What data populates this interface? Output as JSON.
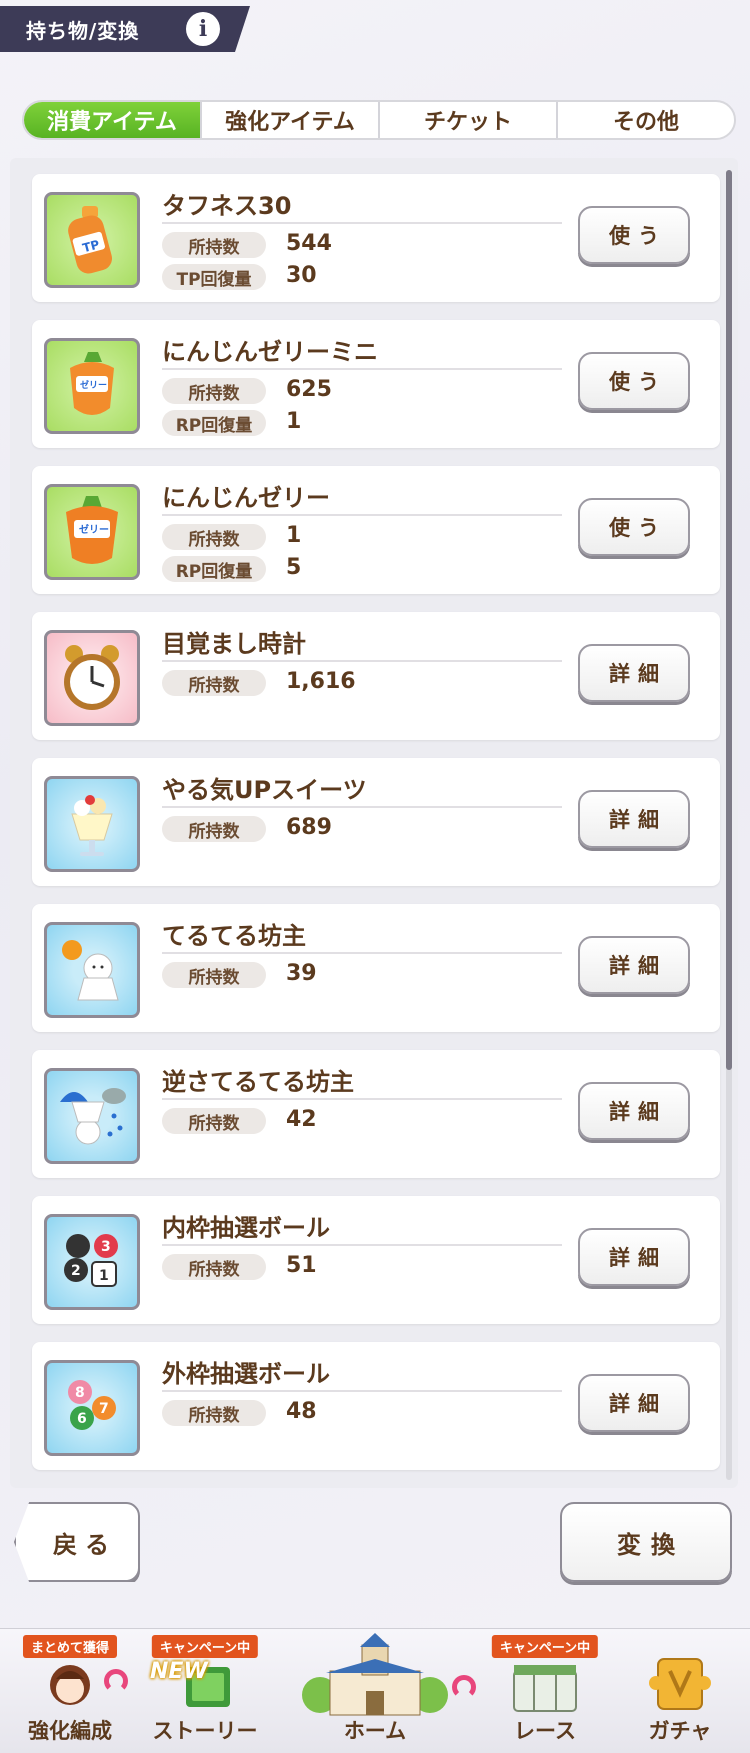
{
  "header": {
    "title": "持ち物/変換",
    "info_icon": "i"
  },
  "tabs": [
    {
      "label": "消費アイテム",
      "active": true
    },
    {
      "label": "強化アイテム",
      "active": false
    },
    {
      "label": "チケット",
      "active": false
    },
    {
      "label": "その他",
      "active": false
    }
  ],
  "items": [
    {
      "name": "タフネス30",
      "icon": "tp-bottle-icon",
      "rows": [
        {
          "label": "所持数",
          "value": "544"
        },
        {
          "label": "TP回復量",
          "value": "30"
        }
      ],
      "button": "使う"
    },
    {
      "name": "にんじんゼリーミニ",
      "icon": "carrot-jelly-mini-icon",
      "rows": [
        {
          "label": "所持数",
          "value": "625"
        },
        {
          "label": "RP回復量",
          "value": "1"
        }
      ],
      "button": "使う"
    },
    {
      "name": "にんじんゼリー",
      "icon": "carrot-jelly-icon",
      "rows": [
        {
          "label": "所持数",
          "value": "1"
        },
        {
          "label": "RP回復量",
          "value": "5"
        }
      ],
      "button": "使う"
    },
    {
      "name": "目覚まし時計",
      "icon": "alarm-clock-icon",
      "rows": [
        {
          "label": "所持数",
          "value": "1,616"
        }
      ],
      "button": "詳細"
    },
    {
      "name": "やる気UPスイーツ",
      "icon": "parfait-icon",
      "rows": [
        {
          "label": "所持数",
          "value": "689"
        }
      ],
      "button": "詳細"
    },
    {
      "name": "てるてる坊主",
      "icon": "teru-teru-bozu-icon",
      "rows": [
        {
          "label": "所持数",
          "value": "39"
        }
      ],
      "button": "詳細"
    },
    {
      "name": "逆さてるてる坊主",
      "icon": "rain-teru-teru-bozu-icon",
      "rows": [
        {
          "label": "所持数",
          "value": "42"
        }
      ],
      "button": "詳細"
    },
    {
      "name": "内枠抽選ボール",
      "icon": "inner-lottery-balls-icon",
      "rows": [
        {
          "label": "所持数",
          "value": "51"
        }
      ],
      "button": "詳細"
    },
    {
      "name": "外枠抽選ボール",
      "icon": "outer-lottery-balls-icon",
      "rows": [
        {
          "label": "所持数",
          "value": "48"
        }
      ],
      "button": "詳細"
    }
  ],
  "footer": {
    "back_label": "戻る",
    "exchange_label": "変換"
  },
  "nav": [
    {
      "label": "強化編成",
      "badge": "まとめて獲得"
    },
    {
      "label": "ストーリー",
      "badge": "キャンペーン中",
      "new": "NEW"
    },
    {
      "label": "ホーム",
      "badge": ""
    },
    {
      "label": "レース",
      "badge": "キャンペーン中"
    },
    {
      "label": "ガチャ",
      "badge": ""
    }
  ]
}
